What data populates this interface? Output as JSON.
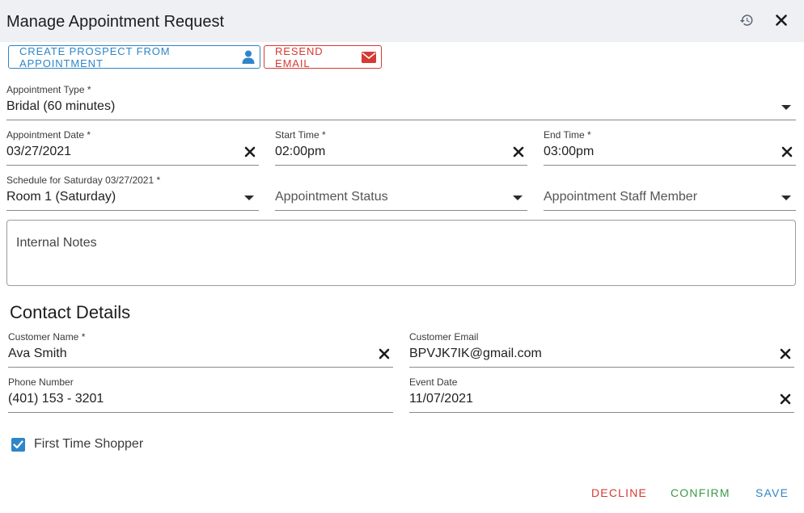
{
  "dialog": {
    "title": "Manage Appointment Request",
    "history_icon": "history-icon",
    "close_icon": "close-icon"
  },
  "actions": {
    "create_prospect_label": "CREATE PROSPECT FROM APPOINTMENT",
    "create_prospect_icon": "person-icon",
    "resend_email_label": "RESEND EMAIL",
    "resend_email_icon": "envelope-icon"
  },
  "appointment": {
    "type": {
      "label": "Appointment Type *",
      "value": "Bridal (60 minutes)"
    },
    "date": {
      "label": "Appointment Date *",
      "value": "03/27/2021"
    },
    "start_time": {
      "label": "Start Time *",
      "value": "02:00pm"
    },
    "end_time": {
      "label": "End Time *",
      "value": "03:00pm"
    },
    "schedule": {
      "label": "Schedule for Saturday 03/27/2021 *",
      "value": "Room 1 (Saturday)"
    },
    "status": {
      "placeholder": "Appointment Status"
    },
    "staff": {
      "placeholder": "Appointment Staff Member"
    },
    "internal_notes": {
      "placeholder": "Internal Notes"
    }
  },
  "contact": {
    "section_title": "Contact Details",
    "customer_name": {
      "label": "Customer Name *",
      "value": "Ava Smith"
    },
    "customer_email": {
      "label": "Customer Email",
      "value": "BPVJK7IK@gmail.com"
    },
    "phone": {
      "label": "Phone Number",
      "value": "(401) 153 - 3201"
    },
    "event_date": {
      "label": "Event Date",
      "value": "11/07/2021"
    },
    "first_time_shopper": {
      "label": "First Time Shopper",
      "checked": true
    }
  },
  "footer": {
    "decline_label": "DECLINE",
    "confirm_label": "CONFIRM",
    "save_label": "SAVE"
  },
  "colors": {
    "accent_blue": "#2e86c8",
    "danger_red": "#d63a32",
    "success_green": "#3b9a46",
    "header_bg": "#eef0f3"
  }
}
